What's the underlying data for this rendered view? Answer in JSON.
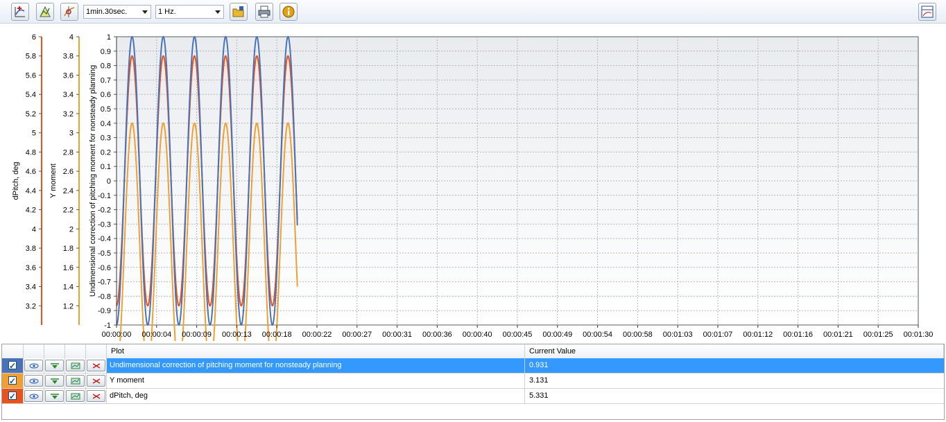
{
  "toolbar": {
    "icons": [
      "add-curve-icon",
      "chart-settings-icon",
      "marker-icon",
      "folder-open-icon",
      "print-icon",
      "info-icon",
      "layout-icon"
    ],
    "duration": {
      "selected": "1min.30sec."
    },
    "frequency": {
      "selected": "1 Hz."
    }
  },
  "colors": {
    "undim": "#4a72b8",
    "ymoment": "#f0a030",
    "dpitch": "#e8531c",
    "selected_row": "#3399ff"
  },
  "chart_data": {
    "type": "line",
    "grid": true,
    "x_ticks": [
      "00:00:00",
      "00:00:04",
      "00:00:09",
      "00:00:13",
      "00:00:18",
      "00:00:22",
      "00:00:27",
      "00:00:31",
      "00:00:36",
      "00:00:40",
      "00:00:45",
      "00:00:49",
      "00:00:54",
      "00:00:58",
      "00:01:03",
      "00:01:07",
      "00:01:12",
      "00:01:16",
      "00:01:21",
      "00:01:25",
      "00:01:30"
    ],
    "xlim": [
      0,
      90
    ],
    "axes": [
      {
        "id": "dpitch",
        "label": "dPitch, deg",
        "range": [
          3.0,
          6.0
        ],
        "ticks": [
          "3.2",
          "3.4",
          "3.6",
          "3.8",
          "4",
          "4.2",
          "4.4",
          "4.6",
          "4.8",
          "5",
          "5.2",
          "5.4",
          "5.6",
          "5.8",
          "6"
        ],
        "tick_values": [
          3.2,
          3.4,
          3.6,
          3.8,
          4,
          4.2,
          4.4,
          4.6,
          4.8,
          5,
          5.2,
          5.4,
          5.6,
          5.8,
          6
        ]
      },
      {
        "id": "ymoment",
        "label": "Y moment",
        "range": [
          1.0,
          4.0
        ],
        "ticks": [
          "1.2",
          "1.4",
          "1.6",
          "1.8",
          "2",
          "2.2",
          "2.4",
          "2.6",
          "2.8",
          "3",
          "3.2",
          "3.4",
          "3.6",
          "3.8",
          "4"
        ],
        "tick_values": [
          1.2,
          1.4,
          1.6,
          1.8,
          2,
          2.2,
          2.4,
          2.6,
          2.8,
          3,
          3.2,
          3.4,
          3.6,
          3.8,
          4
        ]
      },
      {
        "id": "undim",
        "label": "Undimensional correction of pitching moment for nonsteady planning",
        "range": [
          -1,
          1
        ],
        "ticks": [
          "-1",
          "-0.9",
          "-0.8",
          "-0.7",
          "-0.6",
          "-0.5",
          "-0.4",
          "-0.3",
          "-0.2",
          "-0.1",
          "0",
          "0.1",
          "0.2",
          "0.3",
          "0.4",
          "0.5",
          "0.6",
          "0.7",
          "0.8",
          "0.9",
          "1"
        ],
        "tick_values": [
          -1,
          -0.9,
          -0.8,
          -0.7,
          -0.6,
          -0.5,
          -0.4,
          -0.3,
          -0.2,
          -0.1,
          0,
          0.1,
          0.2,
          0.3,
          0.4,
          0.5,
          0.6,
          0.7,
          0.8,
          0.9,
          1
        ]
      }
    ],
    "series": [
      {
        "name": "Undimensional correction of pitching moment for nonsteady planning",
        "axis": "undim",
        "period": 3.5,
        "phase": 0.875,
        "amplitude": 1.0,
        "offset": 0.0,
        "t_end": 20.3
      },
      {
        "name": "Y moment",
        "axis": "ymoment",
        "period": 3.5,
        "phase": 0.875,
        "amplitude": 1.3,
        "offset": 1.8,
        "t_end": 20.3
      },
      {
        "name": "dPitch, deg",
        "axis": "dpitch",
        "period": 3.5,
        "phase": 0.875,
        "amplitude": 1.3,
        "offset": 4.5,
        "t_end": 20.3
      }
    ]
  },
  "table": {
    "headers": {
      "plot": "Plot",
      "value": "Current Value"
    },
    "rows": [
      {
        "plot": "Undimensional correction of pitching moment for nonsteady planning",
        "value": "0.931",
        "color": "#4a72b8",
        "checked": true,
        "selected": true
      },
      {
        "plot": "Y moment",
        "value": "3.131",
        "color": "#f0a030",
        "checked": true,
        "selected": false
      },
      {
        "plot": "dPitch, deg",
        "value": "5.331",
        "color": "#e8531c",
        "checked": true,
        "selected": false
      }
    ]
  }
}
